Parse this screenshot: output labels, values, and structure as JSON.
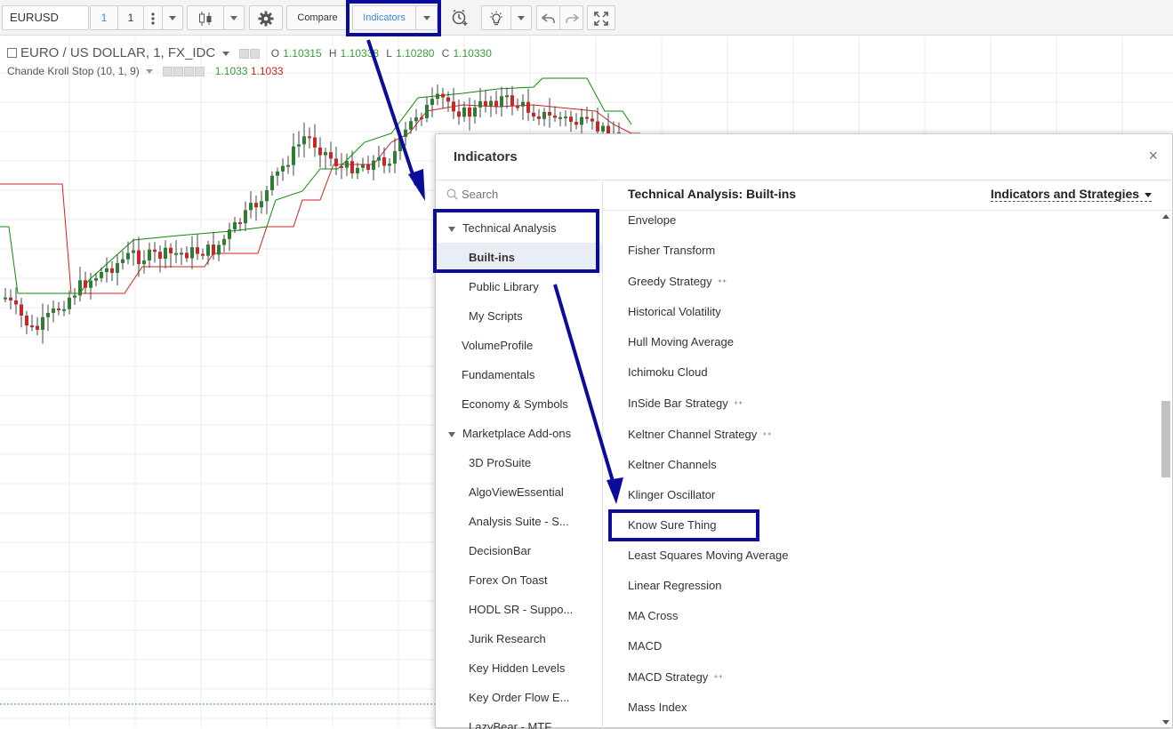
{
  "toolbar": {
    "symbol": "EURUSD",
    "interval_a": "1",
    "interval_b": "1",
    "compare_label": "Compare",
    "indicators_label": "Indicators"
  },
  "chart": {
    "legend": {
      "title": "EURO / US DOLLAR, 1, FX_IDC",
      "o_label": "O",
      "o_value": "1.10315",
      "h_label": "H",
      "h_value": "1.10338",
      "l_label": "L",
      "l_value": "1.10280",
      "c_label": "C",
      "c_value": "1.10330"
    },
    "indicator": {
      "name": "Chande Kroll Stop (10, 1, 9)",
      "value_green": "1.1033",
      "value_red": "1.1033"
    },
    "colors": {
      "up": "#2e7d32",
      "down": "#c62828",
      "stop_green": "#0a8a0a",
      "stop_red": "#d42020"
    }
  },
  "dialog": {
    "title": "Indicators",
    "close_glyph": "×",
    "search_placeholder": "Search",
    "nav": [
      {
        "label": "Technical Analysis",
        "expanded": true
      },
      {
        "label": "Built-ins",
        "selected": true
      },
      {
        "label": "Public Library"
      },
      {
        "label": "My Scripts"
      },
      {
        "label": "VolumeProfile"
      },
      {
        "label": "Fundamentals"
      },
      {
        "label": "Economy & Symbols"
      },
      {
        "label": "Marketplace Add-ons",
        "expanded": true
      },
      {
        "label": "3D ProSuite"
      },
      {
        "label": "AlgoViewEssential"
      },
      {
        "label": "Analysis Suite - S..."
      },
      {
        "label": "DecisionBar"
      },
      {
        "label": "Forex On Toast"
      },
      {
        "label": "HODL SR - Suppo..."
      },
      {
        "label": "Jurik Research"
      },
      {
        "label": "Key Hidden Levels"
      },
      {
        "label": "Key Order Flow E..."
      },
      {
        "label": "LazyBear - MTF..."
      }
    ],
    "section_title": "Technical Analysis: Built-ins",
    "filter_label": "Indicators and Strategies",
    "strategy_glyph": "⁺⁺",
    "items": [
      {
        "label": "Envelope"
      },
      {
        "label": "Fisher Transform"
      },
      {
        "label": "Greedy Strategy",
        "strategy": true
      },
      {
        "label": "Historical Volatility"
      },
      {
        "label": "Hull Moving Average"
      },
      {
        "label": "Ichimoku Cloud"
      },
      {
        "label": "InSide Bar Strategy",
        "strategy": true
      },
      {
        "label": "Keltner Channel Strategy",
        "strategy": true
      },
      {
        "label": "Keltner Channels"
      },
      {
        "label": "Klinger Oscillator"
      },
      {
        "label": "Know Sure Thing"
      },
      {
        "label": "Least Squares Moving Average"
      },
      {
        "label": "Linear Regression"
      },
      {
        "label": "MA Cross"
      },
      {
        "label": "MACD"
      },
      {
        "label": "MACD Strategy",
        "strategy": true
      },
      {
        "label": "Mass Index"
      }
    ]
  },
  "annotations": {
    "color": "#0b0b9c"
  }
}
